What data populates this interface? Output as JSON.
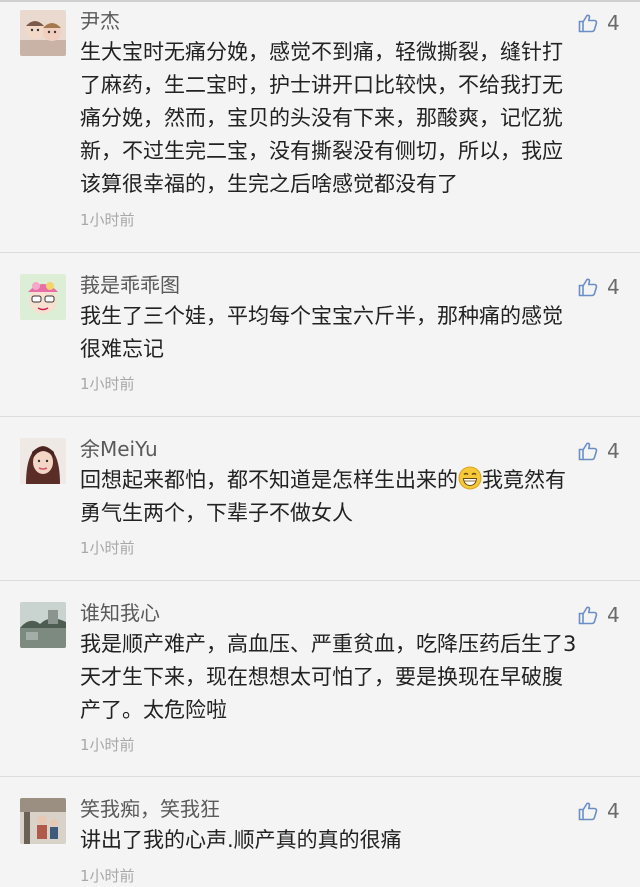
{
  "comments": [
    {
      "username": "尹杰",
      "like_count": "4",
      "lines": [
        "生大宝时无痛分娩，感觉不到痛，轻微撕裂，缝针打",
        "了麻药，生二宝时，护士讲开口比较快，不给我打无",
        "痛分娩，然而，宝贝的头没有下来，那酸爽，记忆犹",
        "新，不过生完二宝，没有撕裂没有侧切，所以，我应",
        "该算很幸福的，生完之后啥感觉都没有了"
      ],
      "time": "1小时前"
    },
    {
      "username": "莪是乖乖图",
      "like_count": "4",
      "lines": [
        "我生了三个娃，平均每个宝宝六斤半，那种痛的感觉",
        "很难忘记"
      ],
      "time": "1小时前"
    },
    {
      "username": "余MeiYu",
      "like_count": "4",
      "line1_before_emoji": "回想起来都怕，都不知道是怎样生出来的",
      "line1_after_emoji": "我竟然有",
      "line2": "勇气生两个，下辈子不做女人",
      "emoji": "grinning-face-emoji",
      "time": "1小时前"
    },
    {
      "username": "谁知我心",
      "like_count": "4",
      "lines": [
        "我是顺产难产，高血压、严重贫血，吃降压药后生了3",
        "天才生下来，现在想想太可怕了，要是换现在早破腹",
        "产了。太危险啦"
      ],
      "time": "1小时前"
    },
    {
      "username": "笑我痴，笑我狂",
      "like_count": "4",
      "lines": [
        "讲出了我的心声.顺产真的真的很痛"
      ],
      "time": "1小时前"
    }
  ],
  "icons": {
    "like": "thumbs-up-icon"
  },
  "colors": {
    "background": "#f4f4f4",
    "username": "#5a5a5a",
    "body_text": "#222222",
    "time": "#a8a8a8",
    "like_icon": "#6b8fc4"
  }
}
